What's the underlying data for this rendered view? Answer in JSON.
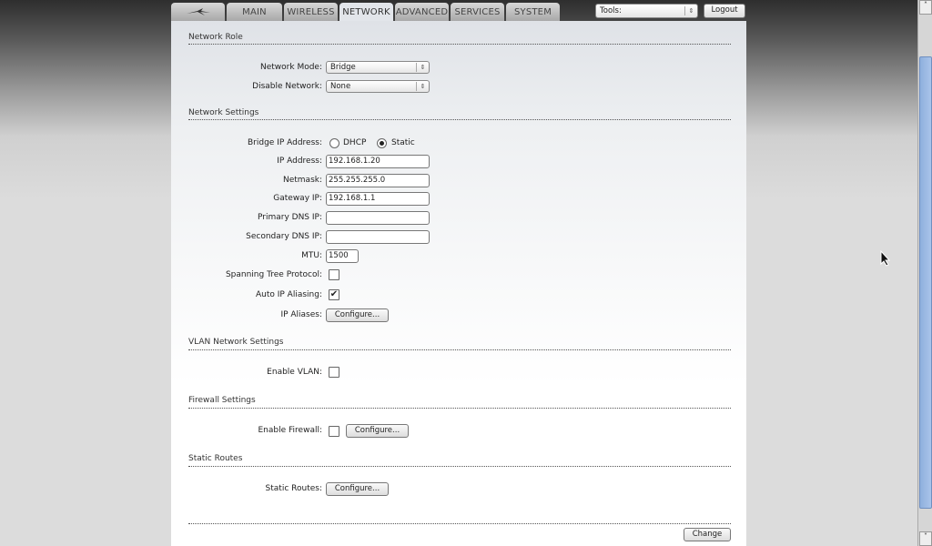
{
  "tabs": [
    {
      "label": "MAIN"
    },
    {
      "label": "WIRELESS"
    },
    {
      "label": "NETWORK"
    },
    {
      "label": "ADVANCED"
    },
    {
      "label": "SERVICES"
    },
    {
      "label": "SYSTEM"
    }
  ],
  "tools": {
    "label": "Tools:"
  },
  "logout": "Logout",
  "network_role": {
    "title": "Network Role",
    "mode_label": "Network Mode:",
    "mode_value": "Bridge",
    "disable_label": "Disable Network:",
    "disable_value": "None"
  },
  "network_settings": {
    "title": "Network Settings",
    "bridge_label": "Bridge IP Address:",
    "dhcp": "DHCP",
    "static": "Static",
    "ip_label": "IP Address:",
    "ip": "192.168.1.20",
    "netmask_label": "Netmask:",
    "netmask": "255.255.255.0",
    "gateway_label": "Gateway IP:",
    "gateway": "192.168.1.1",
    "dns1_label": "Primary DNS IP:",
    "dns1": "",
    "dns2_label": "Secondary DNS IP:",
    "dns2": "",
    "mtu_label": "MTU:",
    "mtu": "1500",
    "stp_label": "Spanning Tree Protocol:",
    "stp": false,
    "alias_label": "Auto IP Aliasing:",
    "alias": true,
    "aliases_label": "IP Aliases:"
  },
  "configure": "Configure...",
  "vlan": {
    "title": "VLAN Network Settings",
    "label": "Enable VLAN:"
  },
  "firewall": {
    "title": "Firewall Settings",
    "label": "Enable Firewall:"
  },
  "routes": {
    "title": "Static Routes",
    "label": "Static Routes:"
  },
  "change": "Change"
}
